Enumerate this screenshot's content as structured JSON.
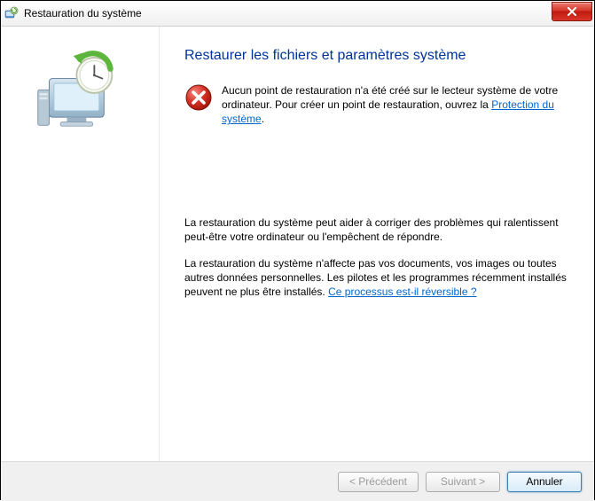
{
  "window": {
    "title": "Restauration du système"
  },
  "main": {
    "heading": "Restaurer les fichiers et paramètres système",
    "error_prefix": "Aucun point de restauration n'a été créé sur le lecteur système de votre ordinateur. Pour créer un point de restauration, ouvrez la ",
    "error_link": "Protection du système",
    "error_suffix": ".",
    "para1": "La restauration du système peut aider à corriger des problèmes qui ralentissent peut-être votre ordinateur ou l'empêchent de répondre.",
    "para2_prefix": "La restauration du système n'affecte pas vos documents, vos images ou toutes autres données personnelles. Les pilotes et les programmes récemment installés peuvent ne plus être installés. ",
    "para2_link": "Ce processus est-il réversible ?"
  },
  "buttons": {
    "back": "< Précédent",
    "next": "Suivant >",
    "cancel": "Annuler"
  }
}
